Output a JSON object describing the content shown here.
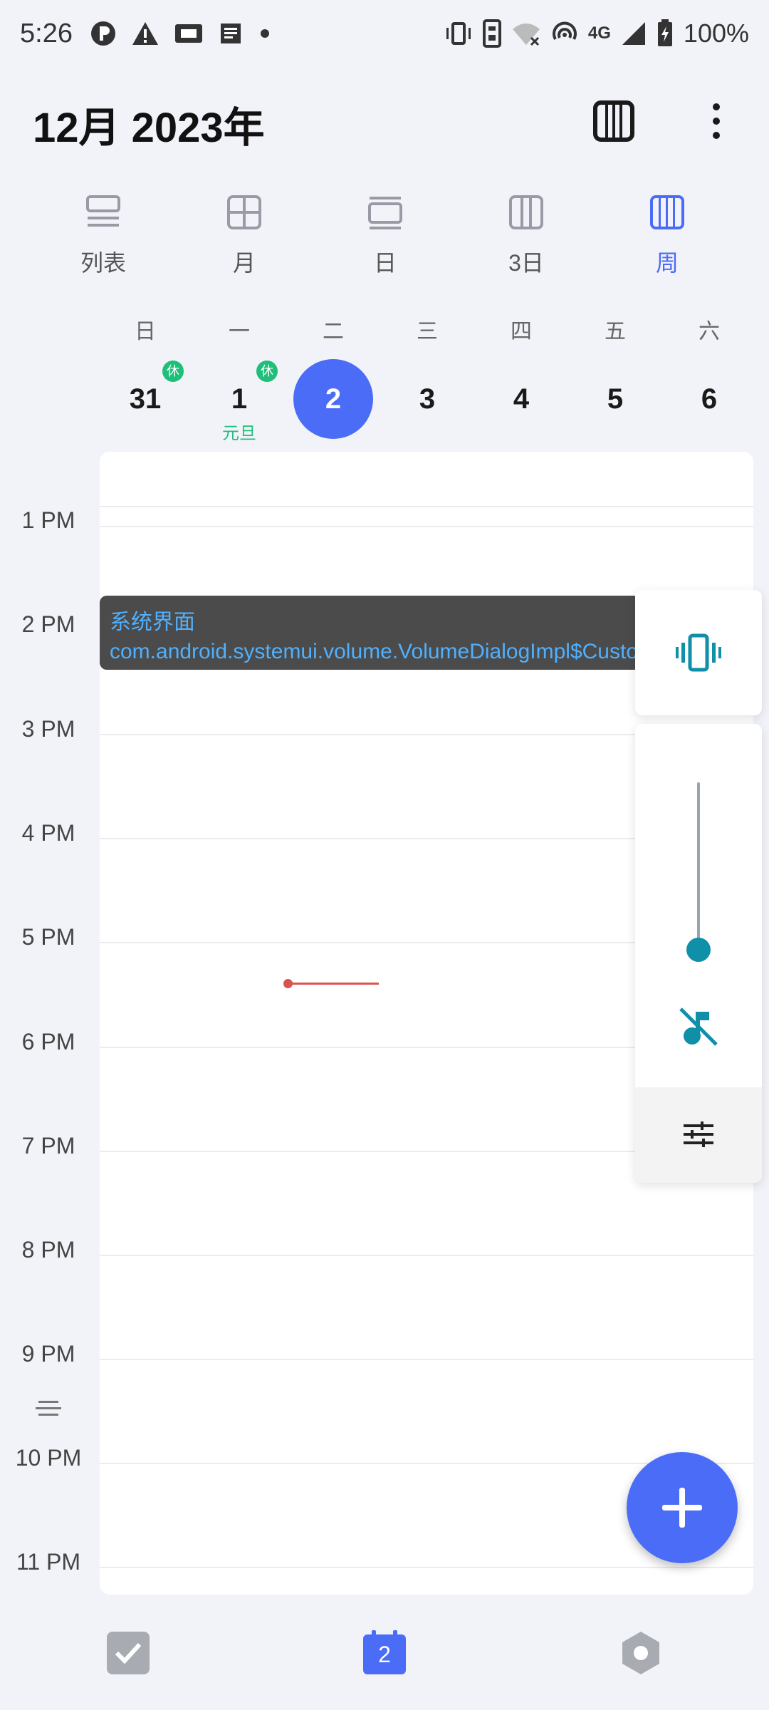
{
  "status_bar": {
    "time": "5:26",
    "battery": "100%",
    "network_label": "4G"
  },
  "header": {
    "title": "12月 2023年"
  },
  "view_tabs": [
    {
      "label": "列表",
      "icon": "list-view-icon",
      "active": false
    },
    {
      "label": "月",
      "icon": "month-view-icon",
      "active": false
    },
    {
      "label": "日",
      "icon": "day-view-icon",
      "active": false
    },
    {
      "label": "3日",
      "icon": "three-day-view-icon",
      "active": false
    },
    {
      "label": "周",
      "icon": "week-view-icon",
      "active": true
    }
  ],
  "week": {
    "weekdays": [
      "日",
      "一",
      "二",
      "三",
      "四",
      "五",
      "六"
    ],
    "dates": [
      {
        "num": "31",
        "badge": "休",
        "sub": ""
      },
      {
        "num": "1",
        "badge": "休",
        "sub": "元旦"
      },
      {
        "num": "2",
        "badge": "",
        "sub": "",
        "today": true
      },
      {
        "num": "3",
        "badge": "",
        "sub": ""
      },
      {
        "num": "4",
        "badge": "",
        "sub": ""
      },
      {
        "num": "5",
        "badge": "",
        "sub": ""
      },
      {
        "num": "6",
        "badge": "",
        "sub": ""
      }
    ]
  },
  "time_labels": [
    "1 PM",
    "2 PM",
    "3 PM",
    "4 PM",
    "5 PM",
    "6 PM",
    "7 PM",
    "8 PM",
    "9 PM",
    "10 PM",
    "11 PM"
  ],
  "toast": {
    "title": "系统界面",
    "body": "com.android.systemui.volume.VolumeDialogImpl$CustomDialog"
  },
  "volume_panel": {
    "level": 0
  },
  "bottom_nav": {
    "calendar_badge": "2"
  },
  "colors": {
    "accent": "#4a6cf7",
    "holiday": "#1fbf7a",
    "volume_accent": "#0f8fa8",
    "now_indicator": "#d9534f"
  }
}
